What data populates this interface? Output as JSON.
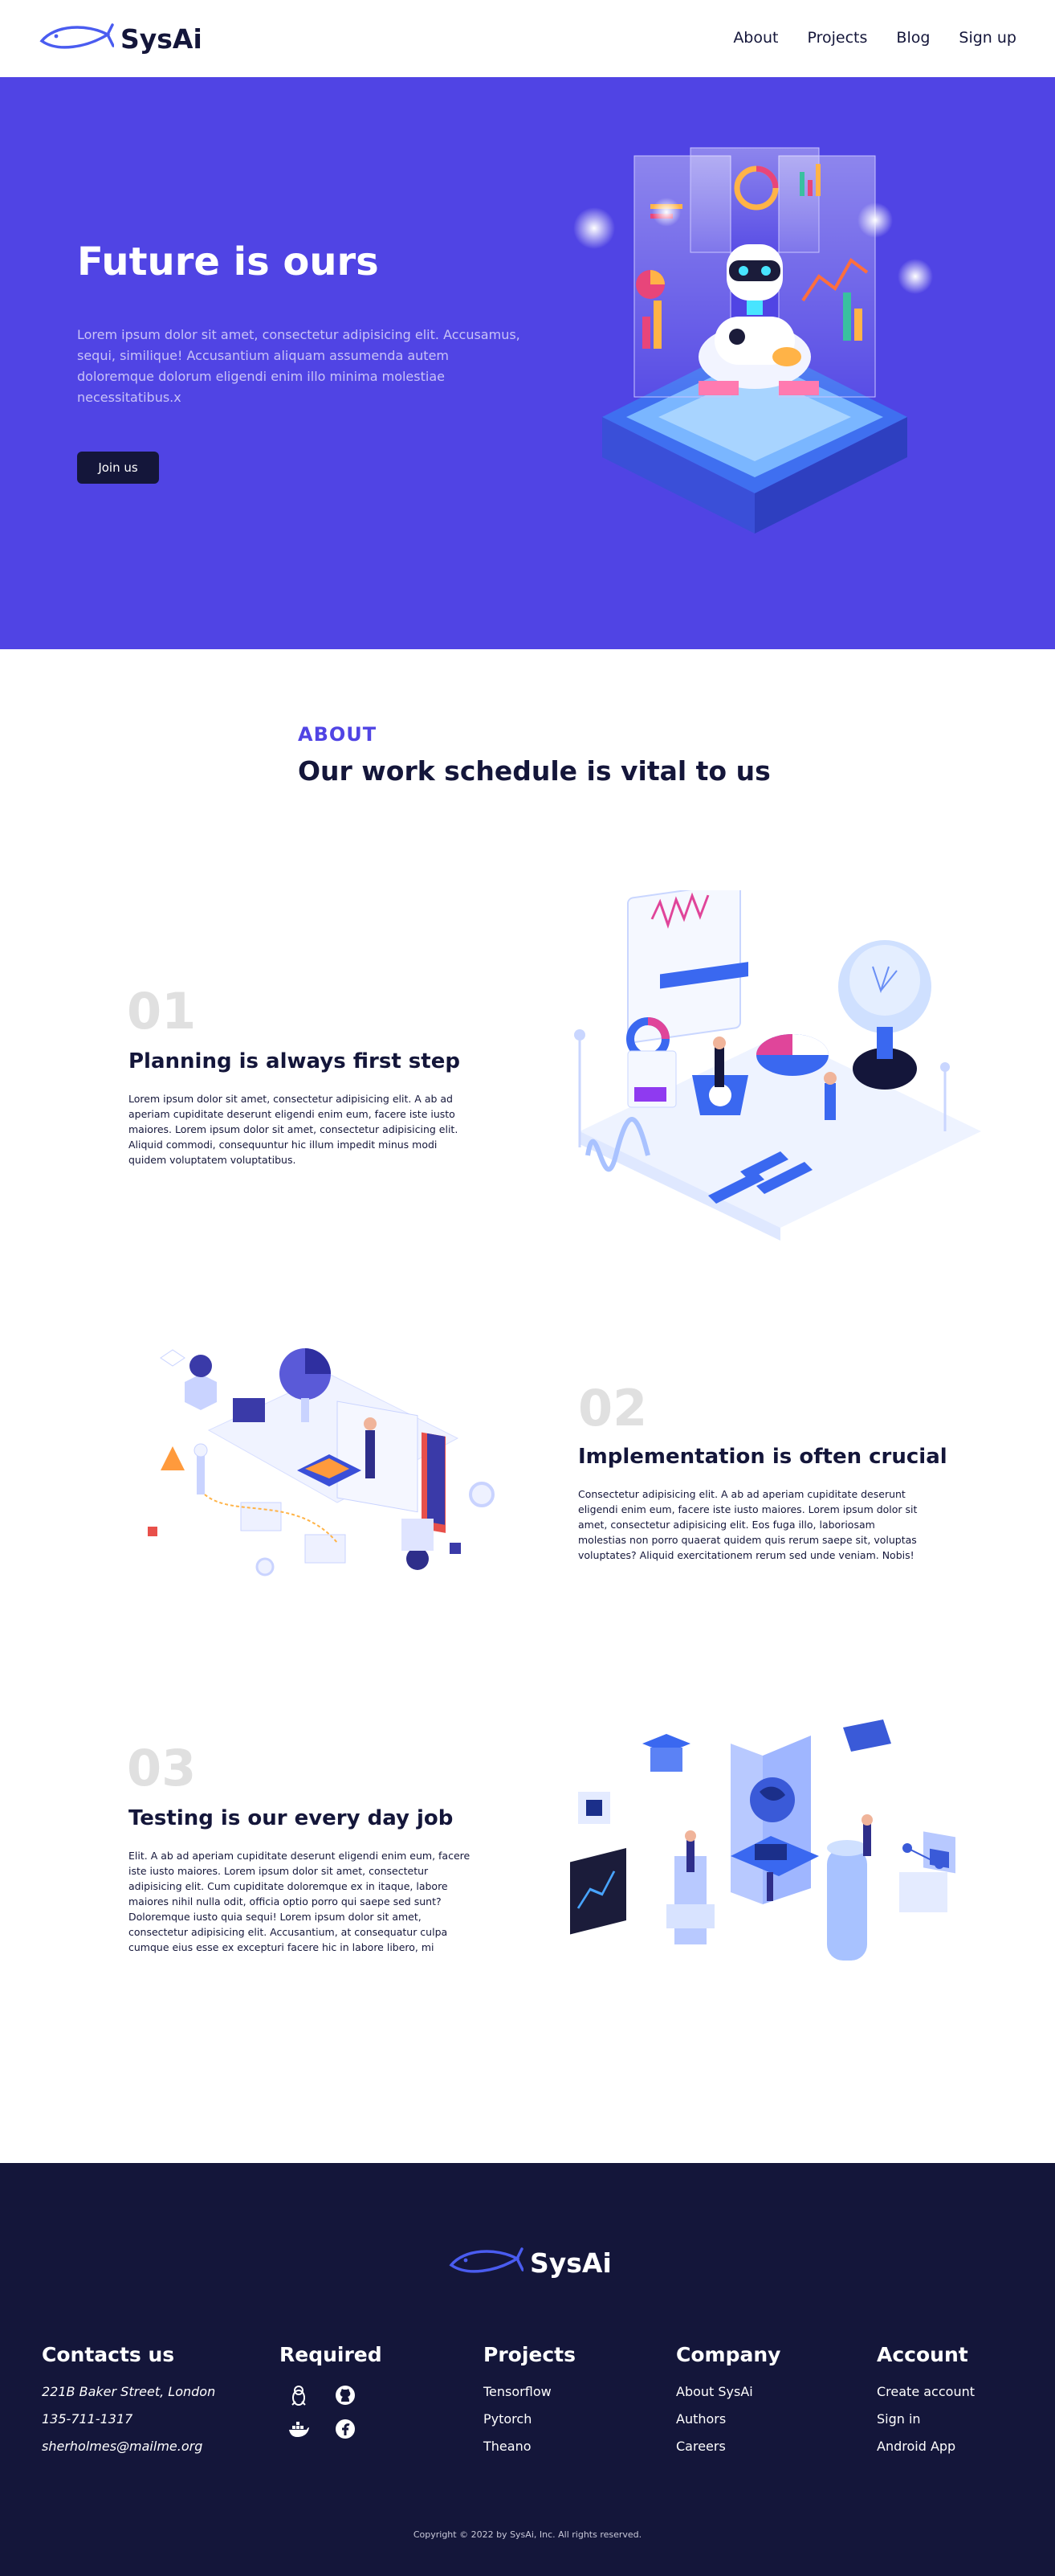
{
  "brand": {
    "name": "SysAi",
    "accent": "#5044e4",
    "dark": "#14163a"
  },
  "nav": {
    "links": [
      "About",
      "Projects",
      "Blog",
      "Sign up"
    ]
  },
  "hero": {
    "title": "Future is ours",
    "text": "Lorem ipsum dolor sit amet, consectetur adipisicing elit. Accusamus, sequi, similique! Accusantium aliquam assumenda autem doloremque dolorum eligendi enim illo minima molestiae necessitatibus.x",
    "button": "Join us"
  },
  "about": {
    "tag": "ABOUT",
    "title": "Our work schedule is vital to us",
    "steps": [
      {
        "num": "01",
        "title": "Planning is always first step",
        "text": "Lorem ipsum dolor sit amet, consectetur adipisicing elit. A ab ad aperiam cupiditate deserunt eligendi enim eum, facere iste iusto maiores. Lorem ipsum dolor sit amet, consectetur adipisicing elit. Aliquid commodi, consequuntur hic illum impedit minus modi quidem voluptatem voluptatibus."
      },
      {
        "num": "02",
        "title": "Implementation is often crucial",
        "text": "Consectetur adipisicing elit. A ab ad aperiam cupiditate deserunt eligendi enim eum, facere iste iusto maiores. Lorem ipsum dolor sit amet, consectetur adipisicing elit. Eos fuga illo, laboriosam molestias non porro quaerat quidem quis rerum saepe sit, voluptas voluptates? Aliquid exercitationem rerum sed unde veniam. Nobis!"
      },
      {
        "num": "03",
        "title": "Testing is our every day job",
        "text": "Elit. A ab ad aperiam cupiditate deserunt eligendi enim eum, facere iste iusto maiores. Lorem ipsum dolor sit amet, consectetur adipisicing elit. Cum cupiditate doloremque ex in itaque, labore maiores nihil nulla odit, officia optio porro qui saepe sed sunt? Doloremque iusto quia sequi! Lorem ipsum dolor sit amet, consectetur adipisicing elit. Accusantium, at consequatur culpa cumque eius esse ex excepturi facere hic in labore libero, mi"
      }
    ]
  },
  "footer": {
    "contacts": {
      "title": "Contacts us",
      "items": [
        "221B Baker Street, London",
        "135-711-1317",
        "sherholmes@mailme.org"
      ]
    },
    "required": {
      "title": "Required",
      "icons": [
        "linux-icon",
        "github-icon",
        "docker-icon",
        "fedora-icon"
      ]
    },
    "projects": {
      "title": "Projects",
      "items": [
        "Tensorflow",
        "Pytorch",
        "Theano"
      ]
    },
    "company": {
      "title": "Company",
      "items": [
        "About SysAi",
        "Authors",
        "Careers"
      ]
    },
    "account": {
      "title": "Account",
      "items": [
        "Create account",
        "Sign in",
        "Android App"
      ]
    },
    "copyright": "Copyright © 2022 by SysAi, Inc. All rights reserved."
  }
}
